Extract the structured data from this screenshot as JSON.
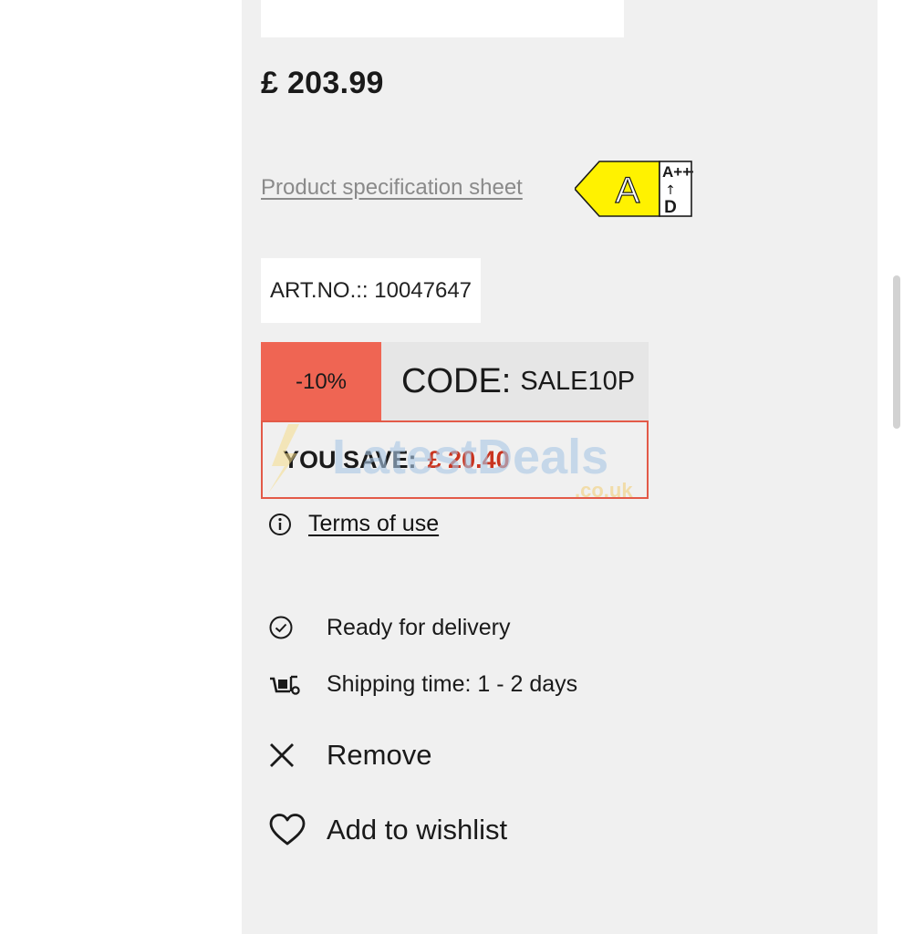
{
  "product": {
    "price": "£ 203.99",
    "spec_link": "Product specification sheet",
    "energy": {
      "class": "A",
      "scale_top": "A+++",
      "scale_arrow": "↑",
      "scale_bottom": "D",
      "color": "#fff200"
    },
    "article_number": "ART.NO.:: 10047647"
  },
  "deal": {
    "discount": "-10%",
    "code_label": "CODE:",
    "code_value": "SALE10P",
    "you_save_label": "YOU SAVE:",
    "you_save_amount": "£ 20.40",
    "discount_color": "#ef6553"
  },
  "terms": {
    "icon": "info-icon",
    "label": "Terms of use"
  },
  "availability": {
    "status": {
      "icon": "check-circle-icon",
      "label": "Ready for delivery"
    },
    "shipping": {
      "icon": "delivery-truck-icon",
      "label": "Shipping time: 1 - 2 days"
    }
  },
  "actions": {
    "remove": {
      "icon": "close-icon",
      "label": "Remove"
    },
    "wishlist": {
      "icon": "heart-icon",
      "label": "Add to wishlist"
    }
  },
  "watermark": {
    "brand": "LatestDeals",
    "domain": ".co.uk"
  }
}
